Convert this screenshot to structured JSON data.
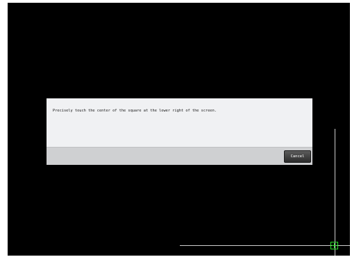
{
  "dialog": {
    "message": "Precisely touch the center of the square at the lower right of the screen.",
    "cancel_label": "Cancel"
  },
  "calibration_target": {
    "position": "lower-right",
    "icon": "crosshair-target-icon",
    "color": "#29e329"
  },
  "colors": {
    "screen_background": "#000000",
    "dialog_background": "#f0f1f3",
    "footer_background": "#cfd0d2",
    "guide_line": "#cfcfcf"
  }
}
